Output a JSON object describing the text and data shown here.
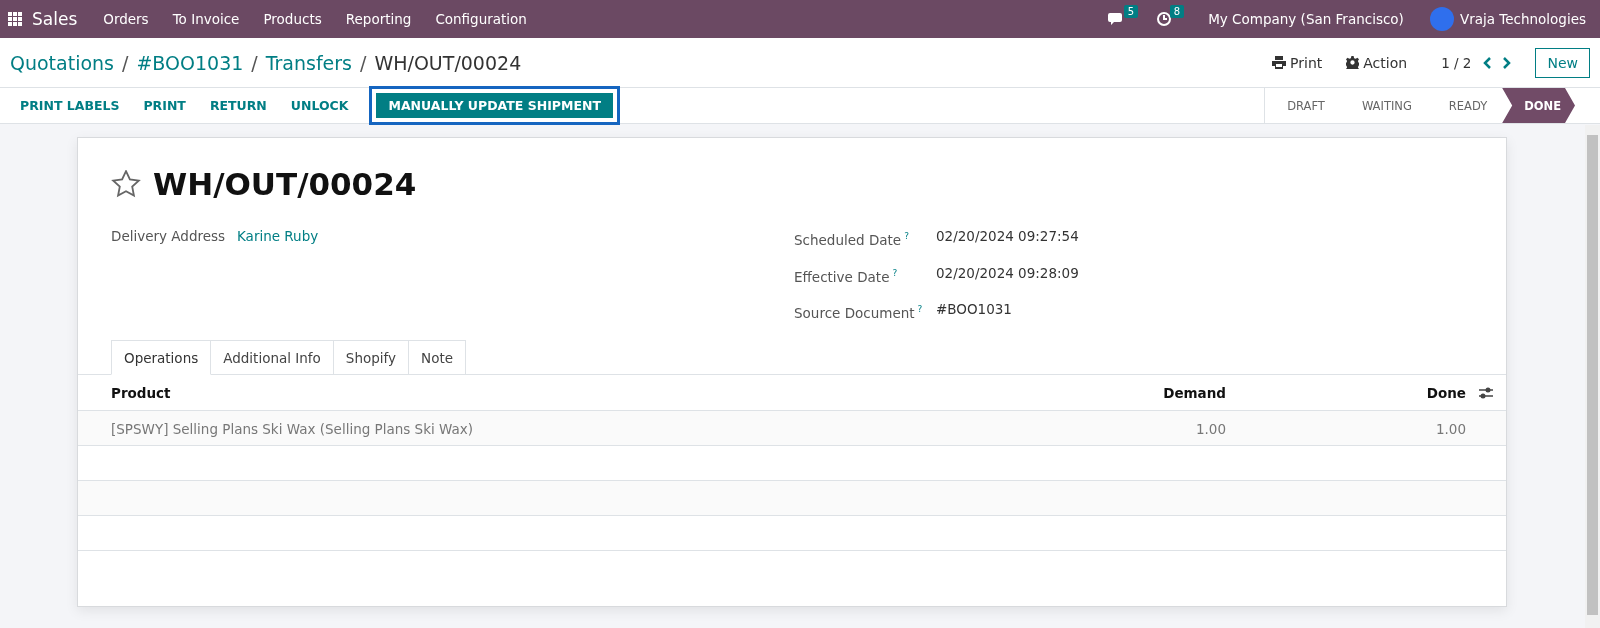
{
  "navbar": {
    "app": "Sales",
    "menu": [
      "Orders",
      "To Invoice",
      "Products",
      "Reporting",
      "Configuration"
    ],
    "messages_count": "5",
    "activities_count": "8",
    "company": "My Company (San Francisco)",
    "user": "Vraja Technologies"
  },
  "breadcrumb": {
    "separator": "/",
    "links": [
      "Quotations",
      "#BOO1031",
      "Transfers"
    ],
    "current": "WH/OUT/00024"
  },
  "control_panel": {
    "print": "Print",
    "action": "Action",
    "pager": "1 / 2",
    "new_button": "New"
  },
  "action_buttons": [
    {
      "label": "PRINT LABELS",
      "kind": "link"
    },
    {
      "label": "PRINT",
      "kind": "link"
    },
    {
      "label": "RETURN",
      "kind": "link"
    },
    {
      "label": "UNLOCK",
      "kind": "link"
    },
    {
      "label": "MANUALLY UPDATE SHIPMENT",
      "kind": "primary"
    }
  ],
  "status_stages": [
    {
      "label": "DRAFT",
      "selected": false
    },
    {
      "label": "WAITING",
      "selected": false
    },
    {
      "label": "READY",
      "selected": false
    },
    {
      "label": "DONE",
      "selected": true
    }
  ],
  "record": {
    "title": "WH/OUT/00024",
    "starred": false,
    "left_fields": [
      {
        "label": "Delivery Address",
        "value": "Karine Ruby",
        "link": true
      }
    ],
    "right_fields": [
      {
        "label": "Scheduled Date",
        "help": "?",
        "value": "02/20/2024 09:27:54"
      },
      {
        "label": "Effective Date",
        "help": "?",
        "value": "02/20/2024 09:28:09"
      },
      {
        "label": "Source Document",
        "help": "?",
        "value": "#BOO1031"
      }
    ]
  },
  "tabs": [
    {
      "label": "Operations",
      "selected": true
    },
    {
      "label": "Additional Info",
      "selected": false
    },
    {
      "label": "Shopify",
      "selected": false
    },
    {
      "label": "Note",
      "selected": false
    }
  ],
  "table": {
    "columns": [
      "Product",
      "Demand",
      "Done"
    ],
    "rows": [
      {
        "product": "[SPSWY] Selling Plans Ski Wax (Selling Plans Ski Wax)",
        "demand": "1.00",
        "done": "1.00"
      }
    ]
  }
}
